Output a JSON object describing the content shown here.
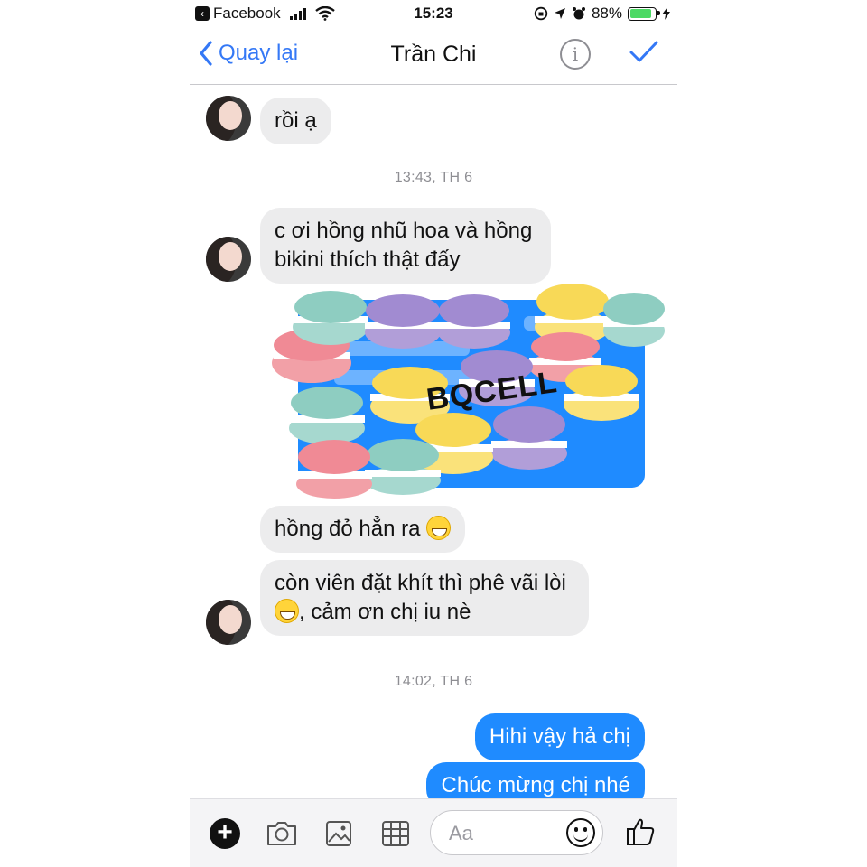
{
  "status_bar": {
    "app_name": "Facebook",
    "time": "15:23",
    "battery": "88%",
    "battery_level": 0.88
  },
  "nav": {
    "back_label": "Quay lại",
    "title": "Trần Chi",
    "info_glyph": "i"
  },
  "messages": {
    "m1": "rồi ạ",
    "ts1": "13:43, TH 6",
    "m2_line1": "c ơi hồng nhũ hoa và hồng",
    "m2_line2": "bikini thích thật đấy",
    "image_watermark": "BQCELL",
    "m3": "hồng đỏ hẳn ra",
    "m4_line1": "còn viên đặt khít thì phê vãi lòi",
    "m4_line2": ", cảm ơn chị iu nè",
    "ts2": "14:02, TH 6",
    "out1": "Hihi vậy hả chị",
    "out2": "Chúc mừng chị nhé"
  },
  "input": {
    "placeholder": "Aa"
  },
  "colors": {
    "accent": "#1f8bff",
    "incoming_bubble": "#ececed",
    "nav_blue": "#3478f6"
  },
  "icons": [
    "chevron-left-icon",
    "info-icon",
    "checkmark-icon",
    "wifi-icon",
    "battery-icon",
    "plus-icon",
    "camera-icon",
    "gallery-icon",
    "sticker-icon",
    "emoji-icon",
    "thumbs-up-icon",
    "messenger-badge-icon"
  ]
}
